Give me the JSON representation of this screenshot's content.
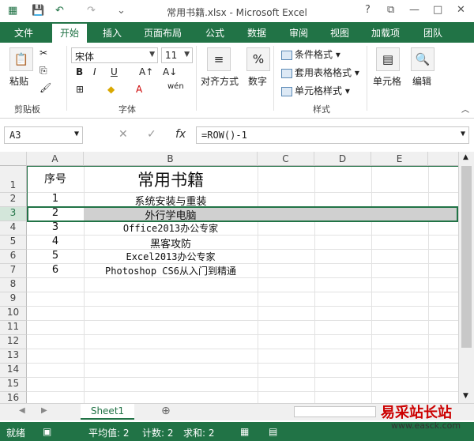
{
  "window": {
    "title": "常用书籍.xlsx - Microsoft Excel",
    "help": "?",
    "min": "—",
    "max": "□",
    "close": "✕"
  },
  "tabs": [
    "文件",
    "开始",
    "插入",
    "页面布局",
    "公式",
    "数据",
    "审阅",
    "视图",
    "加载项",
    "团队"
  ],
  "ribbon": {
    "clipboard": {
      "paste": "粘贴",
      "label": "剪贴板"
    },
    "font": {
      "name": "宋体",
      "size": "11",
      "label": "字体",
      "bold": "B",
      "italic": "I",
      "underline": "U"
    },
    "alignment": {
      "label": "对齐方式"
    },
    "number": {
      "label": "数字",
      "icon": "%"
    },
    "styles": {
      "cond": "条件格式",
      "table": "套用表格格式",
      "cell": "单元格样式",
      "label": "样式"
    },
    "cells": {
      "label": "单元格"
    },
    "editing": {
      "label": "编辑"
    }
  },
  "formula_bar": {
    "name_box": "A3",
    "formula": "=ROW()-1",
    "fx": "fx"
  },
  "columns": [
    "A",
    "B",
    "C",
    "D",
    "E"
  ],
  "rows": [
    "1",
    "2",
    "3",
    "4",
    "5",
    "6",
    "7",
    "8",
    "9",
    "10",
    "11",
    "12",
    "13",
    "14",
    "15",
    "16"
  ],
  "table": {
    "header": {
      "a": "序号",
      "b": "常用书籍"
    },
    "rows": [
      {
        "a": "1",
        "b": "系统安装与重装"
      },
      {
        "a": "2",
        "b": "外行学电脑"
      },
      {
        "a": "3",
        "b": "Office2013办公专家"
      },
      {
        "a": "4",
        "b": "黑客攻防"
      },
      {
        "a": "5",
        "b": "Excel2013办公专家"
      },
      {
        "a": "6",
        "b": "Photoshop CS6从入门到精通"
      }
    ]
  },
  "sheet_tab": "Sheet1",
  "status": {
    "ready": "就绪",
    "avg": "平均值: 2",
    "count": "计数: 2",
    "sum": "求和: 2"
  },
  "watermark": {
    "main": "易采站长站",
    "url": "www.easck.com"
  }
}
